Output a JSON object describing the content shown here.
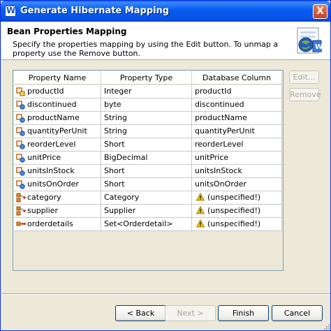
{
  "window": {
    "title": "Generate Hibernate Mapping",
    "close_glyph": "X"
  },
  "header": {
    "title": "Bean Properties Mapping",
    "description": "Specify the properties mapping by using the Edit button. To unmap a property use the Remove button."
  },
  "table": {
    "columns": [
      "Property Name",
      "Property Type",
      "Database Column"
    ],
    "rows": [
      {
        "name": "productId",
        "type": "Integer",
        "column": "productId",
        "icon": "id-property-icon",
        "warning": false
      },
      {
        "name": "discontinued",
        "type": "byte",
        "column": "discontinued",
        "icon": "simple-property-icon",
        "warning": false
      },
      {
        "name": "productName",
        "type": "String",
        "column": "productName",
        "icon": "simple-property-icon",
        "warning": false
      },
      {
        "name": "quantityPerUnit",
        "type": "String",
        "column": "quantityPerUnit",
        "icon": "simple-property-icon",
        "warning": false
      },
      {
        "name": "reorderLevel",
        "type": "Short",
        "column": "reorderLevel",
        "icon": "simple-property-icon",
        "warning": false
      },
      {
        "name": "unitPrice",
        "type": "BigDecimal",
        "column": "unitPrice",
        "icon": "simple-property-icon",
        "warning": false
      },
      {
        "name": "unitsInStock",
        "type": "Short",
        "column": "unitsInStock",
        "icon": "simple-property-icon",
        "warning": false
      },
      {
        "name": "unitsOnOrder",
        "type": "Short",
        "column": "unitsOnOrder",
        "icon": "simple-property-icon",
        "warning": false
      },
      {
        "name": "category",
        "type": "Category",
        "column": "(unspecified!)",
        "icon": "relation-property-icon",
        "warning": true
      },
      {
        "name": "supplier",
        "type": "Supplier",
        "column": "(unspecified!)",
        "icon": "relation-property-icon",
        "warning": true
      },
      {
        "name": "orderdetails",
        "type": "Set<Orderdetail>",
        "column": "(unspecified!)",
        "icon": "collection-property-icon",
        "warning": true
      }
    ]
  },
  "side_buttons": {
    "edit": "Edit...",
    "remove": "Remove"
  },
  "footer": {
    "back": "< Back",
    "next": "Next >",
    "finish": "Finish",
    "cancel": "Cancel"
  },
  "colors": {
    "titlebar": "#0a5ef5",
    "window_bg": "#ece9d8",
    "warning": "#f5c400"
  }
}
